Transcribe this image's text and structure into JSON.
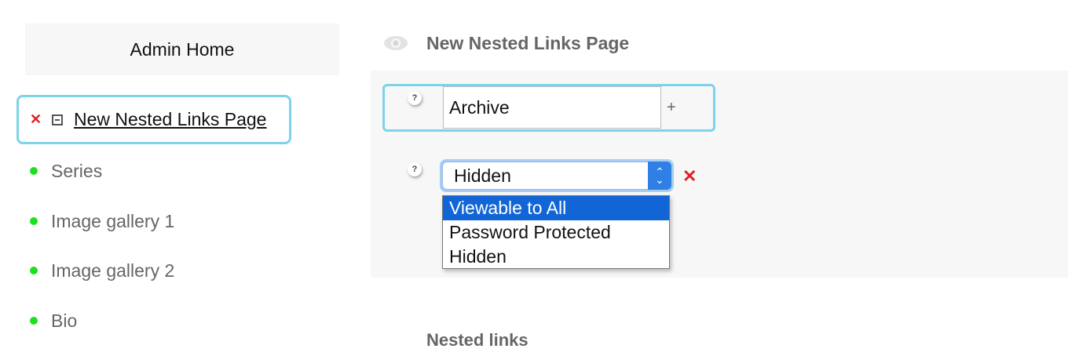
{
  "sidebar": {
    "admin_home": "Admin Home",
    "current": {
      "label": "New Nested Links Page",
      "delete_icon": "x-icon",
      "collapse_icon": "minus-box-icon"
    },
    "items": [
      {
        "label": "Series"
      },
      {
        "label": "Image gallery 1"
      },
      {
        "label": "Image gallery 2"
      },
      {
        "label": "Bio"
      }
    ]
  },
  "main": {
    "visibility_icon": "eye-icon",
    "page_title": "New Nested Links Page",
    "name_field": {
      "value": "Archive",
      "add_label": "+",
      "help_label": "?"
    },
    "visibility": {
      "selected": "Hidden",
      "help_label": "?",
      "options": [
        "Viewable to All",
        "Password Protected",
        "Hidden"
      ],
      "highlighted": "Viewable to All",
      "delete_icon": "red-x-icon"
    },
    "nested_links_heading": "Nested links"
  },
  "colors": {
    "focus_border": "#7dd3ea",
    "status_dot": "#1ee01e",
    "delete": "#e02020",
    "dropdown_highlight": "#1165d6",
    "panel_bg": "#f7f7f7"
  }
}
